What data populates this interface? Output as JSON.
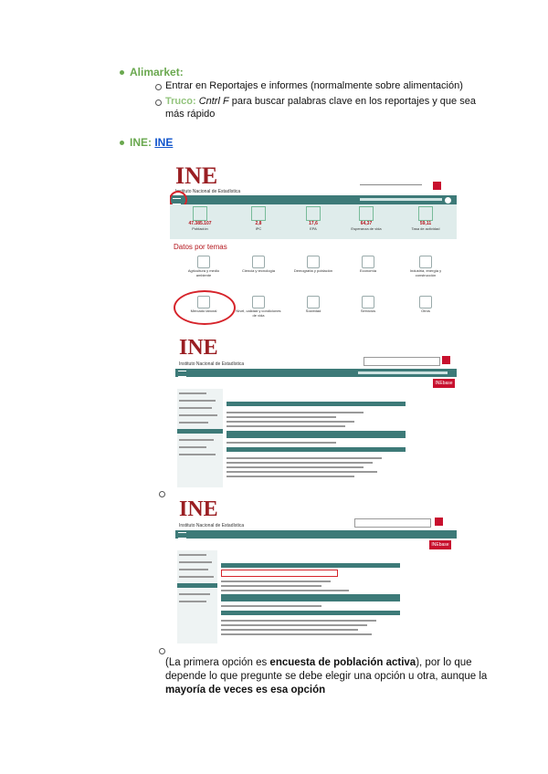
{
  "bullets": [
    {
      "title": "Alimarket:",
      "subitems": [
        "Entrar en Reportajes e informes (normalmente sobre alimentación)",
        {
          "prefix": "Truco:",
          "italic": "Cntrl F",
          "rest": " para buscar palabras clave en los reportajes y que sea",
          "rest2": "más rápido"
        }
      ]
    },
    {
      "title": "INE:",
      "link": "INE"
    }
  ],
  "screenshot1": {
    "logo": "INE",
    "subtitle": "Instituto Nacional de Estadística",
    "stats": [
      {
        "value": "47.385.107",
        "label": "Población"
      },
      {
        "value": "2,8",
        "label": "IPC"
      },
      {
        "value": "17,6",
        "label": "EPA"
      },
      {
        "value": "64,37",
        "label": "Esperanza de vida"
      },
      {
        "value": "59,11",
        "label": "Tasa de actividad"
      }
    ],
    "section_title": "Datos por temas",
    "tiles_row1": [
      "Agricultura y medio ambiente",
      "Ciencia y tecnología",
      "Demografía y población",
      "Economía",
      "Industria, energía y construcción"
    ],
    "tiles_row2": [
      "Mercado laboral",
      "Nivel, calidad y condiciones de vida",
      "Sociedad",
      "Servicios",
      "Otros"
    ]
  },
  "screenshot2": {
    "logo": "INE",
    "subtitle": "Instituto Nacional de Estadística",
    "badge": "INEbase"
  },
  "screenshot3": {
    "logo": "INE",
    "subtitle": "Instituto Nacional de Estadística",
    "badge": "INEbase"
  },
  "conclusion": {
    "line1_a": "(La primera opción es ",
    "line1_b": "encuesta de población activa",
    "line1_c": "), por lo que",
    "line2": "depende lo que pregunte se debe elegir una opción u otra, aunque la",
    "line3": "mayoría de veces es esa opción"
  },
  "colors": {
    "green_bullet": "#6aa84f",
    "ine_red": "#9a1e22",
    "ine_teal": "#3d7a78",
    "link_blue": "#1155cc"
  }
}
